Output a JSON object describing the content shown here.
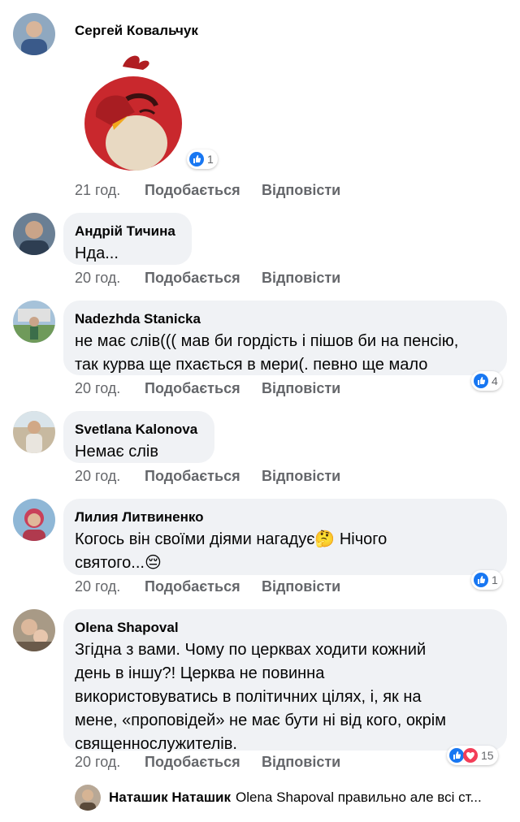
{
  "comments": [
    {
      "author": "Сергей Ковальчук",
      "time": "21 год.",
      "like": "Подобається",
      "reply": "Відповісти",
      "reactions": {
        "types": [
          "like"
        ],
        "count": "1"
      },
      "sticker": "red-angry-bird-facepalm-sticker"
    },
    {
      "author": "Андрій Тичина",
      "text": "Нда...",
      "time": "20 год.",
      "like": "Подобається",
      "reply": "Відповісти"
    },
    {
      "author": "Nadezhda Stanicka",
      "text_lines": [
        "не має слів((( мав би гордість і пішов би на пенсію,",
        "так курва ще пхається в мери(. певно ще мало"
      ],
      "time": "20 год.",
      "like": "Подобається",
      "reply": "Відповісти",
      "reactions": {
        "types": [
          "like"
        ],
        "count": "4"
      }
    },
    {
      "author": "Svetlana Kalonova",
      "text": "Немає слів",
      "time": "20 год.",
      "like": "Подобається",
      "reply": "Відповісти"
    },
    {
      "author": "Лилия Литвиненко",
      "text_lines": [
        "Когось він своїми діями нагадує🤔 Нічого",
        "святого...😔"
      ],
      "time": "20 год.",
      "like": "Подобається",
      "reply": "Відповісти",
      "reactions": {
        "types": [
          "like"
        ],
        "count": "1"
      }
    },
    {
      "author": "Olena Shapoval",
      "text_lines": [
        "Згідна з вами. Чому по церквах ходити кожний",
        "день в іншу?! Церква не повинна",
        "використовуватись в політичних цілях, і, як на",
        "мене, «проповідей» не має бути ні від кого, окрім",
        "священнослужителів."
      ],
      "time": "20 год.",
      "like": "Подобається",
      "reply": "Відповісти",
      "reactions": {
        "types": [
          "like",
          "love"
        ],
        "count": "15"
      }
    }
  ],
  "reply_preview": {
    "author": "Наташик Наташик",
    "text": "Olena Shapoval правильно але всі ст..."
  },
  "colors": {
    "bubble": "#f0f2f5",
    "meta": "#65676b",
    "like_blue": "#1877f2",
    "love_red": "#f33e58"
  }
}
